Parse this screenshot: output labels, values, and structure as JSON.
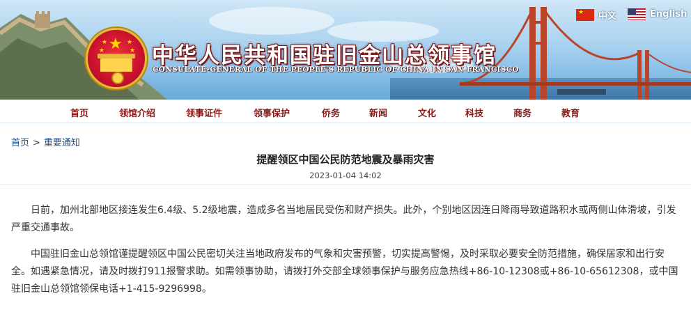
{
  "header": {
    "title": "中华人民共和国驻旧金山总领事馆",
    "subtitle": "CONSULATE-GENERAL OF THE PEOPLE'S REPUBLIC OF CHINA IN SAN FRANCISCO",
    "languages": [
      {
        "label": "中文",
        "flag": "china-flag-icon"
      },
      {
        "label": "English",
        "flag": "usa-flag-icon"
      }
    ]
  },
  "nav": {
    "items": [
      "首页",
      "领馆介绍",
      "领事证件",
      "领事保护",
      "侨务",
      "新闻",
      "文化",
      "科技",
      "商务",
      "教育"
    ]
  },
  "breadcrumb": {
    "home": "首页",
    "separator": ">",
    "current": "重要通知"
  },
  "article": {
    "title": "提醒领区中国公民防范地震及暴雨灾害",
    "date": "2023-01-04 14:02",
    "paragraphs": [
      "日前，加州北部地区接连发生6.4级、5.2级地震，造成多名当地居民受伤和财产损失。此外，个别地区因连日降雨导致道路积水或两侧山体滑坡，引发严重交通事故。",
      "中国驻旧金山总领馆谨提醒领区中国公民密切关注当地政府发布的气象和灾害预警，切实提高警惕，及时采取必要安全防范措施，确保居家和出行安全。如遇紧急情况，请及时拨打911报警求助。如需领事协助，请拨打外交部全球领事保护与服务应急热线+86-10-12308或+86-10-65612308，或中国驻旧金山总领馆领保电话+1-415-9296998。"
    ]
  },
  "colors": {
    "nav_text": "#8b1a1a",
    "link": "#1d4f8c",
    "title_shadow": "#7a1b1b"
  }
}
